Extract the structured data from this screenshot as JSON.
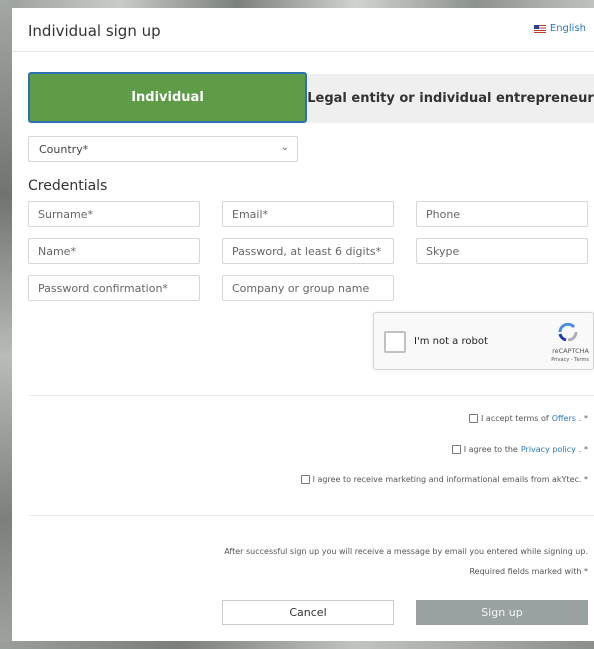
{
  "modal": {
    "title": "Individual sign up",
    "language": "English"
  },
  "tabs": {
    "individual": "Individual",
    "legal": "Legal entity or individual entrepreneur"
  },
  "country": {
    "value": "Country*"
  },
  "credentials": {
    "title": "Credentials",
    "surname": "Surname*",
    "email": "Email*",
    "phone": "Phone",
    "name": "Name*",
    "password": "Password, at least 6 digits*",
    "skype": "Skype",
    "password_confirmation": "Password confirmation*",
    "company": "Company or group name"
  },
  "recaptcha": {
    "label": "I'm not a robot",
    "brand": "reCAPTCHA",
    "terms": "Privacy - Terms"
  },
  "agreements": {
    "offers_prefix": "I accept terms of",
    "offers_link": "Offers",
    "offers_suffix": ". *",
    "privacy_prefix": "I agree to the",
    "privacy_link": "Privacy policy",
    "privacy_suffix": ". *",
    "marketing": "I agree to receive marketing and informational emails from akYtec. *"
  },
  "info": {
    "message": "After successful sign up you will receive a message by email you entered while signing up.",
    "required": "Required fields marked with *"
  },
  "buttons": {
    "cancel": "Cancel",
    "signup": "Sign up"
  },
  "colors": {
    "individual_tab": "#5e9c47",
    "signup_button": "#99a1a3",
    "link": "#2a7ab8"
  }
}
